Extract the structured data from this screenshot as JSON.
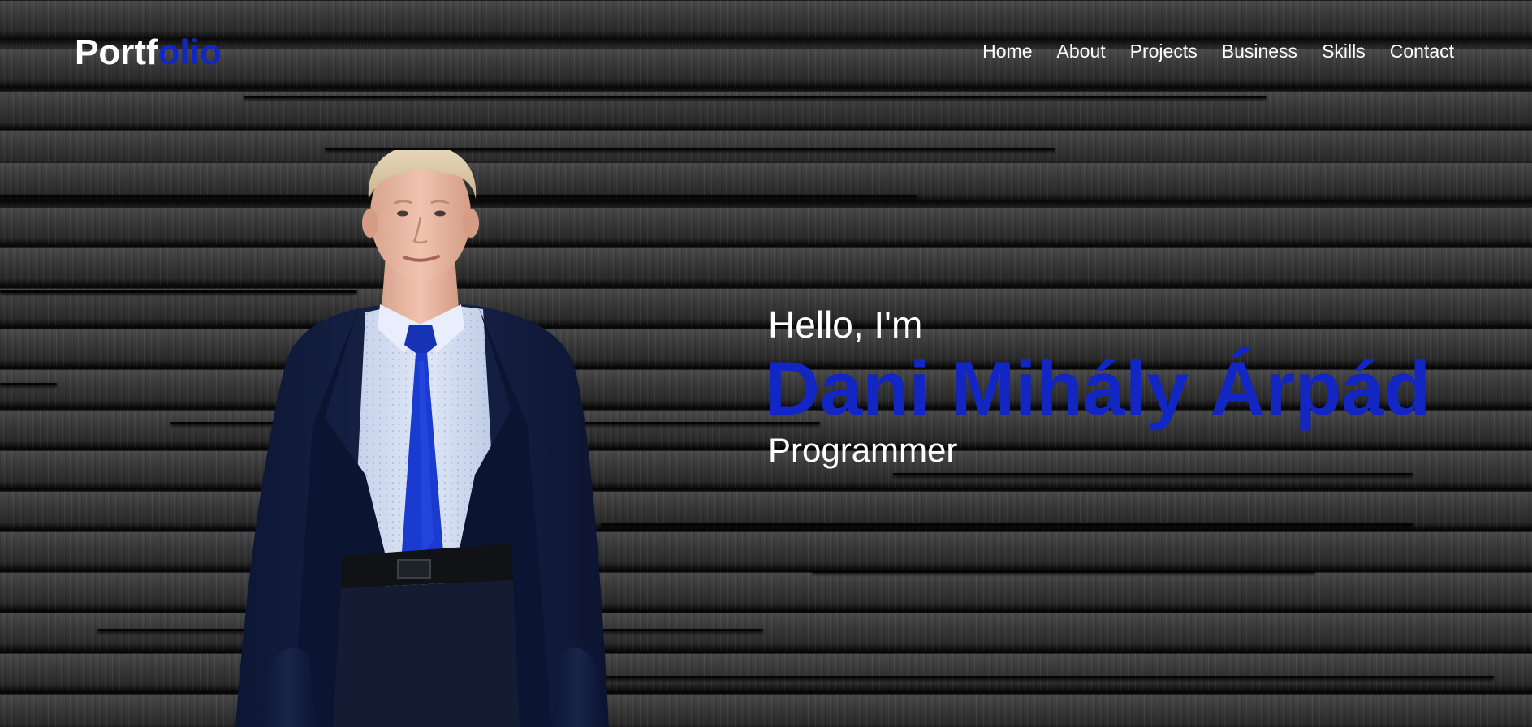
{
  "navbar": {
    "logo_part1": "Portf",
    "logo_part2": "olio",
    "links": [
      {
        "label": "Home"
      },
      {
        "label": "About"
      },
      {
        "label": "Projects"
      },
      {
        "label": "Business"
      },
      {
        "label": "Skills"
      },
      {
        "label": "Contact"
      }
    ]
  },
  "hero": {
    "greeting": "Hello, I'm",
    "name": "Dani Mihály Árpád",
    "role": "Programmer"
  },
  "colors": {
    "accent": "#1226c4",
    "text": "#ffffff",
    "background": "#1e1e1e"
  }
}
